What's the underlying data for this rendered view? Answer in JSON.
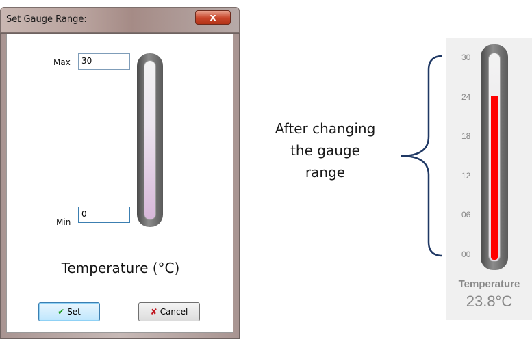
{
  "dialog": {
    "title": "Set Gauge Range:",
    "close_glyph": "x",
    "max_label": "Max",
    "max_value": "30",
    "min_label": "Min",
    "min_value": "0",
    "gauge_title": "Temperature (°C)",
    "set_label": "Set",
    "cancel_label": "Cancel"
  },
  "annotation": {
    "lines": [
      "After changing",
      "the gauge",
      "range"
    ]
  },
  "gauge": {
    "ticks": [
      "30",
      "24",
      "18",
      "12",
      "06",
      "00"
    ],
    "range": [
      0,
      30
    ],
    "value": 23.8,
    "title": "Temperature",
    "value_text": "23.8°C",
    "fill_color": "#ff0000"
  },
  "colors": {
    "accent_check": "#1e9b1e",
    "accent_cross": "#c0121c",
    "brace": "#1f3864"
  },
  "icons": {
    "set": "check-icon",
    "cancel": "cross-icon",
    "close": "close-icon"
  }
}
